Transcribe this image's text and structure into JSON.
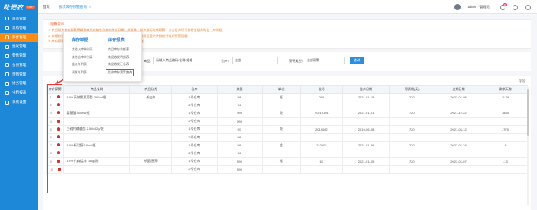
{
  "sidebar": {
    "logo": "助记农",
    "badge": "ERP",
    "items": [
      {
        "label": "商品管理",
        "active": false
      },
      {
        "label": "采购管理",
        "active": false
      },
      {
        "label": "库存管理",
        "active": true
      },
      {
        "label": "批发管理",
        "active": false
      },
      {
        "label": "零售管理",
        "active": false
      },
      {
        "label": "会员管理",
        "active": false
      },
      {
        "label": "营销管理",
        "active": false
      },
      {
        "label": "财务管理",
        "active": false
      },
      {
        "label": "分析报表",
        "active": false
      },
      {
        "label": "系统设置",
        "active": false
      }
    ]
  },
  "tabs": [
    {
      "label": "首页",
      "current": false
    },
    {
      "label": "批次库存预警查询",
      "current": true,
      "close": "×"
    }
  ],
  "user": {
    "name": "admin（管理员）",
    "notice_count": "12"
  },
  "notice": {
    "title": "• 温馨提示！",
    "lines": [
      "1. 商品批次库存预警是根据商品在每个仓库的生产日期、保质期、批次进行效期预警，点击批次号可查看该批次的出入库明细。",
      "2. 如需修改预警天数，可在商品资料中设置预警天数，系统将自动按照设置的天数进行效期预警提醒。",
      "3. 库存预警中显示红色标记的为已过期或即将过期商品，请及时处理。"
    ]
  },
  "dropdown": {
    "col1": {
      "head": "库存单据",
      "items": [
        "其他入库单列表",
        "其他出库单列表",
        "盘点单列表",
        "调拨单列表"
      ]
    },
    "col2": {
      "head": "库存报表",
      "items": [
        "商品库存余额表",
        "商品收发明细表",
        "商品收发汇总表",
        "批次库存预警查询"
      ],
      "highlight_index": 3
    }
  },
  "filter": {
    "search_label": "商品：",
    "search_placeholder": "请输入商品编码/名称/规格",
    "warehouse_label": "仓库：",
    "warehouse_value": "全部",
    "status_label": "预警类型：",
    "status_value": "全部预警",
    "query_button": "查询"
  },
  "table": {
    "tools_right": "导出",
    "headers": [
      "库存预警",
      "商品名称",
      "商品分类",
      "仓库",
      "数量",
      "单位",
      "批号",
      "生产日期",
      "保质期(天)",
      "过期日期",
      "剩余天数"
    ],
    "rows": [
      [
        "1",
        "10% 高效氯氰菊酯 200ml/瓶",
        "杀虫剂",
        "1号仓库",
        "98",
        "瓶",
        "001",
        "2021-01-15",
        "720",
        "2023-01-05",
        "-1436"
      ],
      [
        "2",
        "",
        "",
        "2号仓库",
        "96",
        "",
        "",
        "",
        "",
        "",
        ""
      ],
      [
        "3",
        "氨基酸 500ml/瓶",
        "",
        "1号仓库",
        "999",
        "袋",
        "20210101",
        "2021-01-01",
        "720",
        "2021-12-22",
        "-835"
      ],
      [
        "4",
        "",
        "",
        "2号仓库",
        "999",
        "",
        "",
        "",
        "",
        "",
        ""
      ],
      [
        "5",
        "三硫代磷酸酯 2.5%/42g/袋",
        "",
        "1号仓库",
        "97",
        "袋",
        "2019082",
        "2019-06-08",
        "720",
        "2021-06-12",
        "-775"
      ],
      [
        "6",
        "",
        "",
        "2号仓库",
        "96",
        "",
        "",
        "",
        "",
        "",
        ""
      ],
      [
        "7",
        "10% 精功醇 10 ml/瓶",
        "",
        "1号仓库",
        "99",
        "盒",
        "210002",
        "2021-01-26",
        "720",
        "2023-01-16",
        "-4"
      ],
      [
        "8",
        "",
        "",
        "2号仓库",
        "98",
        "",
        "",
        "",
        "",
        "",
        ""
      ],
      [
        "9",
        "10% 代森锰锌 15kg/袋",
        "杀菌/营养",
        "1号仓库",
        "890",
        "瓶",
        "63",
        "2021-01-05",
        "720",
        "2023-01-07",
        "-13"
      ],
      [
        "10",
        "",
        "",
        "2号仓库",
        "890",
        "",
        "",
        "",
        "",
        "",
        ""
      ]
    ]
  },
  "colors": {
    "sidebar": "#1e88d8",
    "active": "#fa8c16",
    "accent": "#2a8fe0",
    "alert": "#e53935"
  }
}
